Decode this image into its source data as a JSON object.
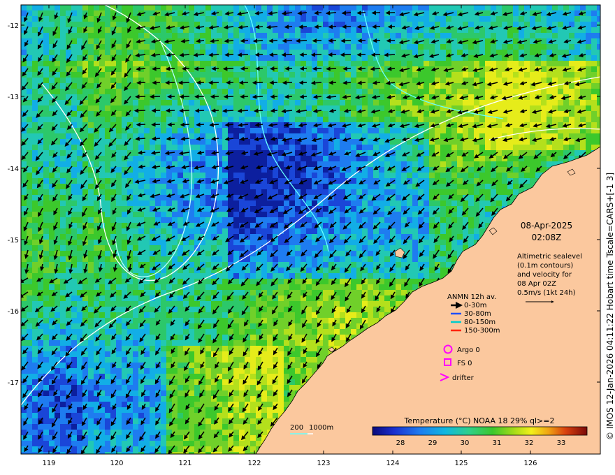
{
  "date": "08-Apr-2025",
  "time": "02:08Z",
  "altimetry": {
    "line1": "Altimetric sealevel",
    "line2": "(0.1m contours)",
    "line3": "and velocity for",
    "line4": "08 Apr 02Z",
    "line5": "0.5m/s (1kt 24h)"
  },
  "anmn": {
    "title": "ANMN 12h av.",
    "items": [
      {
        "label": "0-30m",
        "color": "#000000"
      },
      {
        "label": "30-80m",
        "color": "#1f4fff"
      },
      {
        "label": "80-150m",
        "color": "#00cccc"
      },
      {
        "label": "150-300m",
        "color": "#ff2200"
      }
    ]
  },
  "argo_label": "Argo 0",
  "fs_label": "FS 0",
  "drifter_label": "drifter",
  "bathy": {
    "label1": "200",
    "label2": "1000m"
  },
  "colorbar": {
    "title": "Temperature (°C) NOAA 18 29% ql>=2",
    "ticks": [
      "28",
      "29",
      "30",
      "31",
      "32",
      "33"
    ]
  },
  "x_ticks": [
    "119",
    "120",
    "121",
    "122",
    "123",
    "124",
    "125",
    "126"
  ],
  "y_ticks": [
    "-12",
    "-13",
    "-14",
    "-15",
    "-16",
    "-17"
  ],
  "credit": "© IMOS 12-Jan-2026 04:11:22 Hobart time Tscale=CARS+[-1 3]",
  "colors": {
    "land": "#fbc89e",
    "marker": "#ff00ff"
  }
}
